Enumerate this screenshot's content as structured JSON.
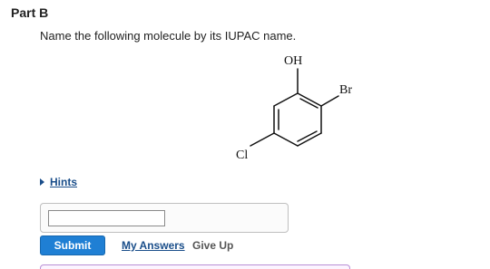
{
  "part": {
    "title": "Part B"
  },
  "question": {
    "text": "Name the following molecule by its IUPAC name."
  },
  "molecule": {
    "labels": {
      "oh": "OH",
      "br": "Br",
      "cl": "Cl"
    }
  },
  "hints": {
    "label": "Hints",
    "icon": "caret-right-icon"
  },
  "answer": {
    "value": "",
    "placeholder": ""
  },
  "actions": {
    "submit_label": "Submit",
    "my_answers_label": "My Answers",
    "give_up_label": "Give Up"
  },
  "colors": {
    "submit_bg": "#1f7fd4",
    "link": "#1a4e8a",
    "feedback_border": "#b98fd6"
  }
}
